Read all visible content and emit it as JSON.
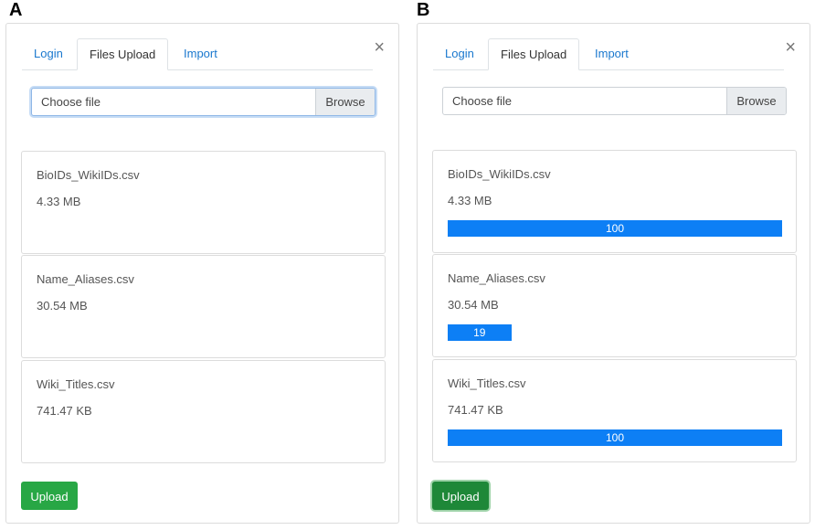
{
  "panels": [
    {
      "letter": "A",
      "close_glyph": "×",
      "tabs": [
        {
          "label": "Login"
        },
        {
          "label": "Files Upload"
        },
        {
          "label": "Import"
        }
      ],
      "active_tab": 1,
      "file_input": {
        "placeholder": "Choose file",
        "browse_label": "Browse"
      },
      "files": [
        {
          "name": "BioIDs_WikiIDs.csv",
          "size": "4.33 MB"
        },
        {
          "name": "Name_Aliases.csv",
          "size": "30.54 MB"
        },
        {
          "name": "Wiki_Titles.csv",
          "size": "741.47 KB"
        }
      ],
      "upload_label": "Upload"
    },
    {
      "letter": "B",
      "close_glyph": "×",
      "tabs": [
        {
          "label": "Login"
        },
        {
          "label": "Files Upload"
        },
        {
          "label": "Import"
        }
      ],
      "active_tab": 1,
      "file_input": {
        "placeholder": "Choose file",
        "browse_label": "Browse"
      },
      "files": [
        {
          "name": "BioIDs_WikiIDs.csv",
          "size": "4.33 MB",
          "progress": "100"
        },
        {
          "name": "Name_Aliases.csv",
          "size": "30.54 MB",
          "progress": "19"
        },
        {
          "name": "Wiki_Titles.csv",
          "size": "741.47 KB",
          "progress": "100"
        }
      ],
      "upload_label": "Upload"
    }
  ],
  "colors": {
    "accent_blue": "#0d7ff5",
    "upload_green": "#28a745",
    "tab_link": "#1a78ce"
  }
}
